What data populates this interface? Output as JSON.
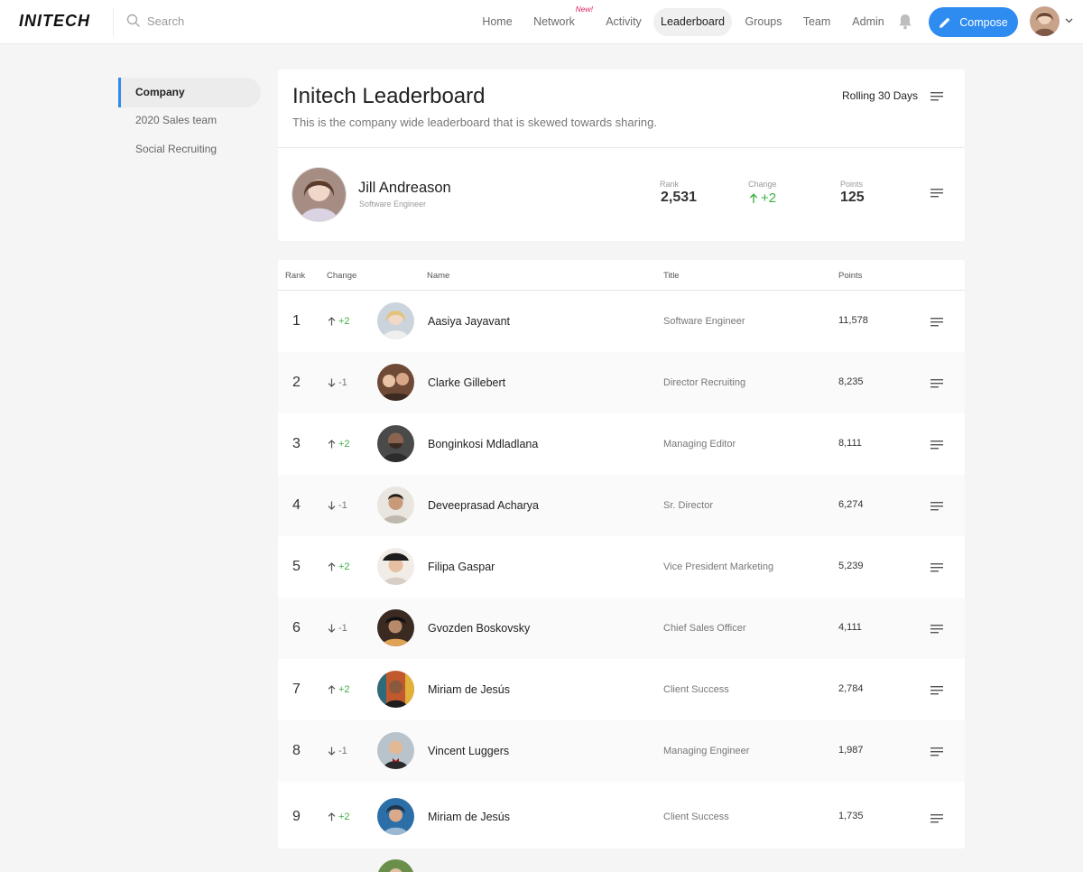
{
  "app": {
    "logo": "INITECH"
  },
  "search": {
    "placeholder": "Search"
  },
  "nav": {
    "items": [
      {
        "label": "Home"
      },
      {
        "label": "Network",
        "badge": "New!"
      },
      {
        "label": "Activity"
      },
      {
        "label": "Leaderboard",
        "active": true
      },
      {
        "label": "Groups"
      },
      {
        "label": "Team"
      },
      {
        "label": "Admin"
      }
    ],
    "compose_label": "Compose",
    "accent": "#2e8bf0",
    "badge_color": "#e0245e"
  },
  "sidebar": {
    "items": [
      {
        "label": "Company",
        "active": true
      },
      {
        "label": "2020 Sales team"
      },
      {
        "label": "Social Recruiting"
      }
    ]
  },
  "leaderboard": {
    "title": "Initech Leaderboard",
    "subtitle": "This is the company wide leaderboard that is skewed towards sharing.",
    "period": "Rolling 30 Days"
  },
  "me": {
    "name": "Jill Andreason",
    "title": "Software Engineer",
    "rank_label": "Rank",
    "rank": "2,531",
    "change_label": "Change",
    "change": "+2",
    "points_label": "Points",
    "points": "125"
  },
  "table": {
    "headers": {
      "rank": "Rank",
      "change": "Change",
      "name": "Name",
      "title": "Title",
      "points": "Points"
    },
    "rows": [
      {
        "rank": "1",
        "change": "+2",
        "dir": "up",
        "name": "Aasiya Jayavant",
        "title": "Software Engineer",
        "points": "11,578"
      },
      {
        "rank": "2",
        "change": "-1",
        "dir": "down",
        "name": "Clarke Gillebert",
        "title": "Director Recruiting",
        "points": "8,235"
      },
      {
        "rank": "3",
        "change": "+2",
        "dir": "up",
        "name": "Bonginkosi Mdladlana",
        "title": "Managing Editor",
        "points": "8,111"
      },
      {
        "rank": "4",
        "change": "-1",
        "dir": "down",
        "name": "Deveeprasad Acharya",
        "title": "Sr. Director",
        "points": "6,274"
      },
      {
        "rank": "5",
        "change": "+2",
        "dir": "up",
        "name": "Filipa Gaspar",
        "title": "Vice President Marketing",
        "points": "5,239"
      },
      {
        "rank": "6",
        "change": "-1",
        "dir": "down",
        "name": "Gvozden Boskovsky",
        "title": "Chief Sales Officer",
        "points": "4,111"
      },
      {
        "rank": "7",
        "change": "+2",
        "dir": "up",
        "name": "Miriam de Jesús",
        "title": "Client Success",
        "points": "2,784"
      },
      {
        "rank": "8",
        "change": "-1",
        "dir": "down",
        "name": "Vincent Luggers",
        "title": "Managing Engineer",
        "points": "1,987"
      },
      {
        "rank": "9",
        "change": "+2",
        "dir": "up",
        "name": "Miriam de Jesús",
        "title": "Client Success",
        "points": "1,735"
      }
    ]
  }
}
